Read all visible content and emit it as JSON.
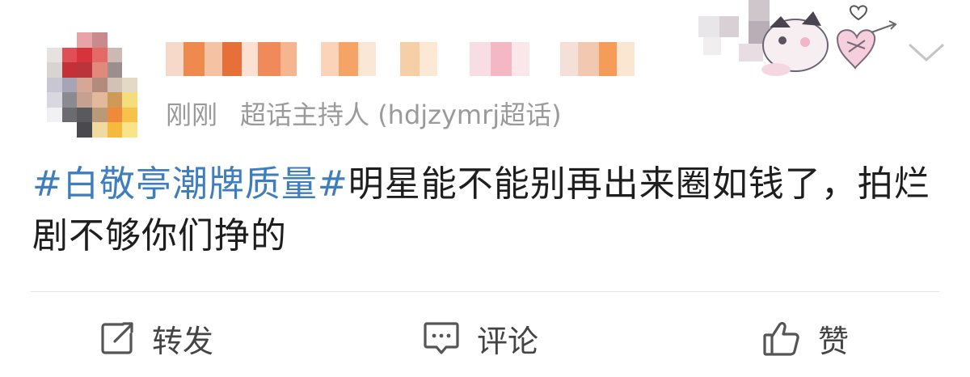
{
  "header": {
    "timestamp": "刚刚",
    "source": "超话主持人 (hdjzymrj超话)"
  },
  "post": {
    "topic": "#白敬亭潮牌质量#",
    "text": "明星能不能别再出来圈如钱了，拍烂剧不够你们挣的"
  },
  "actions": {
    "repost_label": "转发",
    "comment_label": "评论",
    "like_label": "赞"
  },
  "icons": {
    "repost": "share-edit-icon",
    "comment": "comment-bubble-icon",
    "like": "thumbs-up-icon",
    "more": "chevron-down-icon"
  },
  "colors": {
    "topic": "#3e7dbe",
    "meta": "#9a9a9a",
    "text": "#1e1e1e",
    "icon": "#555555",
    "divider": "#e6e6e6"
  }
}
